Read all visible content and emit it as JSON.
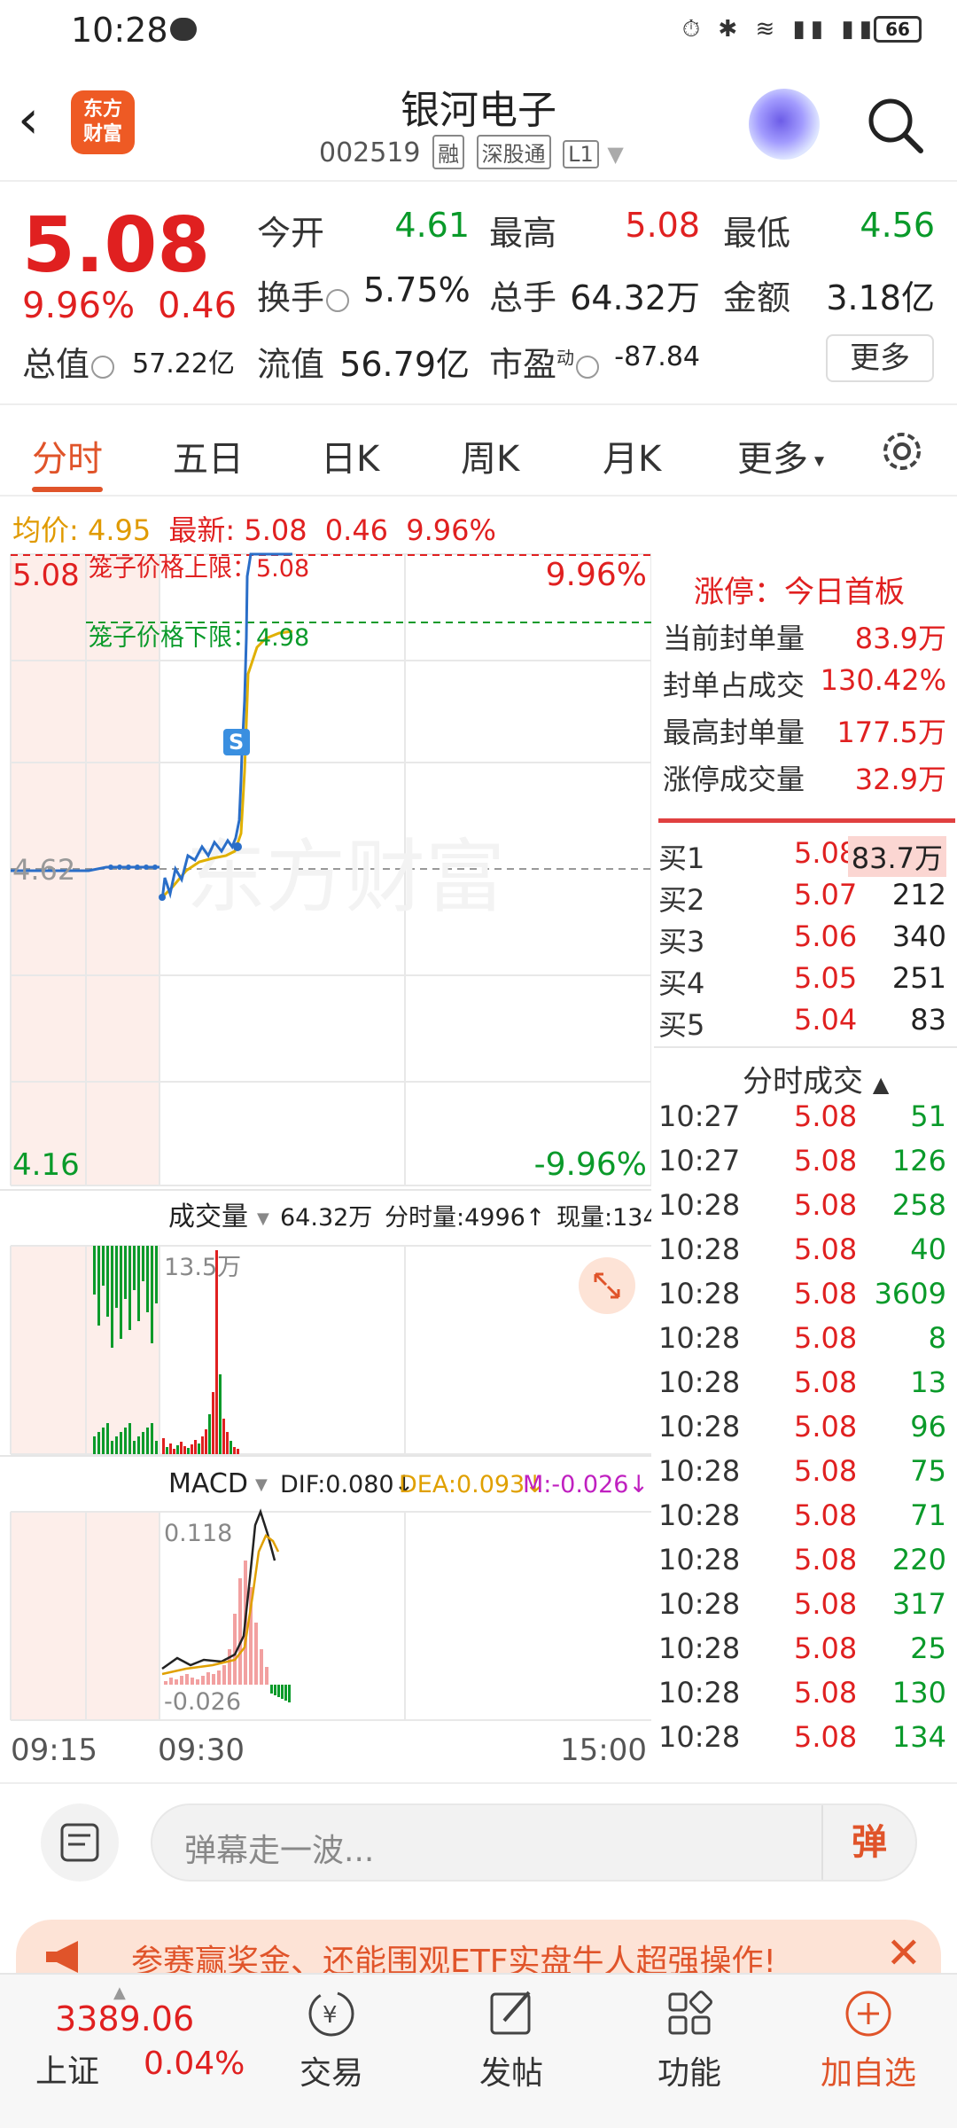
{
  "status_bar": {
    "time": "10:28",
    "battery": "66"
  },
  "header": {
    "logo_line1": "东方",
    "logo_line2": "财富",
    "title": "银河电子",
    "code": "002519",
    "tags": [
      "融",
      "深股通",
      "L1"
    ]
  },
  "quote": {
    "price": "5.08",
    "change_pct": "9.96%",
    "change": "0.46",
    "stats": [
      {
        "label": "今开",
        "value": "4.61",
        "color": "#0a9a2a"
      },
      {
        "label": "最高",
        "value": "5.08",
        "color": "#e02020"
      },
      {
        "label": "最低",
        "value": "4.56",
        "color": "#0a9a2a"
      },
      {
        "label": "换手",
        "value": "5.75%",
        "color": "#222222"
      },
      {
        "label": "总手",
        "value": "64.32万",
        "color": "#222222"
      },
      {
        "label": "金额",
        "value": "3.18亿",
        "color": "#222222"
      },
      {
        "label": "总值",
        "value": "57.22亿",
        "color": "#222222"
      },
      {
        "label": "流值",
        "value": "56.79亿",
        "color": "#222222"
      },
      {
        "label": "市盈",
        "value": "-87.84",
        "color": "#222222"
      }
    ],
    "pe_superscript": "动",
    "more_button": "更多"
  },
  "tabs": [
    "分时",
    "五日",
    "日K",
    "周K",
    "月K",
    "更多"
  ],
  "legend": {
    "avg_label": "均价:",
    "avg_value": "4.95",
    "latest_label": "最新:",
    "latest_value": "5.08",
    "latest_change": "0.46",
    "latest_pct": "9.96%"
  },
  "chart_labels": {
    "upper_price": "5.08",
    "upper_pct": "9.96%",
    "lower_price": "4.16",
    "lower_pct": "-9.96%",
    "mid_price": "4.62",
    "cage_upper": "笼子价格上限：5.08",
    "cage_lower": "笼子价格下限：4.98",
    "watermark": "东方财富",
    "s_marker": "S",
    "volume_tab": "成交量",
    "volume_total": "64.32万",
    "volume_period": "分时量:4996↑",
    "volume_current": "现量:134",
    "volume_max": "13.5万",
    "macd_tab": "MACD",
    "dif": "DIF:0.080↓",
    "dea": "DEA:0.093↓",
    "m": "M:-0.026↓",
    "macd_top": "0.118",
    "macd_bottom": "-0.026",
    "time_start": "09:15",
    "time_open": "09:30",
    "time_end": "15:00"
  },
  "limit_panel": {
    "title": "涨停：今日首板",
    "rows": [
      {
        "label": "当前封单量",
        "value": "83.9万"
      },
      {
        "label": "封单占成交",
        "value": "130.42%"
      },
      {
        "label": "最高封单量",
        "value": "177.5万"
      },
      {
        "label": "涨停成交量",
        "value": "32.9万"
      }
    ]
  },
  "order_book": [
    {
      "label": "买1",
      "price": "5.08",
      "volume": "83.7万"
    },
    {
      "label": "买2",
      "price": "5.07",
      "volume": "212"
    },
    {
      "label": "买3",
      "price": "5.06",
      "volume": "340"
    },
    {
      "label": "买4",
      "price": "5.05",
      "volume": "251"
    },
    {
      "label": "买5",
      "price": "5.04",
      "volume": "83"
    }
  ],
  "trades_title": "分时成交",
  "trades": [
    {
      "time": "10:27",
      "price": "5.08",
      "volume": "51"
    },
    {
      "time": "10:27",
      "price": "5.08",
      "volume": "126"
    },
    {
      "time": "10:28",
      "price": "5.08",
      "volume": "258"
    },
    {
      "time": "10:28",
      "price": "5.08",
      "volume": "40"
    },
    {
      "time": "10:28",
      "price": "5.08",
      "volume": "3609"
    },
    {
      "time": "10:28",
      "price": "5.08",
      "volume": "8"
    },
    {
      "time": "10:28",
      "price": "5.08",
      "volume": "13"
    },
    {
      "time": "10:28",
      "price": "5.08",
      "volume": "96"
    },
    {
      "time": "10:28",
      "price": "5.08",
      "volume": "75"
    },
    {
      "time": "10:28",
      "price": "5.08",
      "volume": "71"
    },
    {
      "time": "10:28",
      "price": "5.08",
      "volume": "220"
    },
    {
      "time": "10:28",
      "price": "5.08",
      "volume": "317"
    },
    {
      "time": "10:28",
      "price": "5.08",
      "volume": "25"
    },
    {
      "time": "10:28",
      "price": "5.08",
      "volume": "130"
    },
    {
      "time": "10:28",
      "price": "5.08",
      "volume": "134"
    }
  ],
  "comment": {
    "placeholder": "弹幕走一波...",
    "send": "弹"
  },
  "banner": {
    "text": "参赛赢奖金、还能围观ETF实盘牛人超强操作!"
  },
  "bottom_nav": {
    "index_value": "3389.06",
    "index_name": "上证",
    "index_pct": "0.04%",
    "items": [
      "交易",
      "发帖",
      "功能",
      "加自选"
    ]
  },
  "colors": {
    "up": "#e02020",
    "down": "#0a9a2a",
    "accent": "#e0542a",
    "avg": "#e0b000",
    "price_line": "#2a6ec8"
  }
}
